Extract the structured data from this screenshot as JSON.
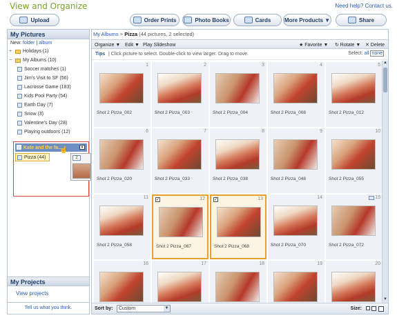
{
  "app": {
    "title": "View and Organize",
    "help_text": "Need help? Contact us."
  },
  "toolbar": {
    "upload": "Upload",
    "order_prints": "Order Prints",
    "photo_books": "Photo Books",
    "cards": "Cards",
    "more_products": "More Products ▼",
    "share": "Share"
  },
  "sidebar": {
    "title": "My Pictures",
    "new_label": "New:",
    "new_folder": "folder",
    "new_sep": "|",
    "new_album": "album",
    "items": [
      {
        "label": "Holidays (1)",
        "kind": "folder",
        "expander": "+"
      },
      {
        "label": "My Albums (10)",
        "kind": "folder",
        "expander": "−"
      },
      {
        "label": "Soccer matches (1)",
        "kind": "album"
      },
      {
        "label": "Jim's Visit to SF (56)",
        "kind": "album"
      },
      {
        "label": "Lacrosse Game (183)",
        "kind": "album"
      },
      {
        "label": "Kids Pool Party (54)",
        "kind": "album"
      },
      {
        "label": "Earth Day (7)",
        "kind": "album"
      },
      {
        "label": "Snow (3)",
        "kind": "album"
      },
      {
        "label": "Valentine's Day (28)",
        "kind": "album"
      },
      {
        "label": "Playing outdoors (12)",
        "kind": "album"
      }
    ],
    "selected_album": "Kate and the fa...",
    "pizza_album": "Pizza (44)",
    "drag_count": "2",
    "projects_title": "My Projects",
    "view_projects": "View projects",
    "tell_us": "Tell us what you think."
  },
  "main": {
    "breadcrumb_root": "My Albums",
    "breadcrumb_sep": ">",
    "breadcrumb_current": "Pizza",
    "breadcrumb_info": "(44 pictures, 2 selected)",
    "organize": "Organize ▼",
    "edit": "Edit ▼",
    "play_slideshow": "Play Slideshow",
    "favorite": "★ Favorite ▼",
    "rotate": "↻ Rotate ▼",
    "delete": "✕ Delete",
    "tips_label": "Tips",
    "tips_text": "|  Click picture to select. Double-click to view larger. Drag to move.",
    "select_label": "Select:",
    "select_all": "all",
    "select_none": "none",
    "sort_label": "Sort by:",
    "sort_value": "Custom",
    "size_label": "Size:"
  },
  "photos": [
    {
      "n": "1",
      "caption": "Shot 2 Pizza_002",
      "selected": false
    },
    {
      "n": "2",
      "caption": "Shot 2 Pizza_003",
      "selected": false
    },
    {
      "n": "3",
      "caption": "Shot 2 Pizza_004",
      "selected": false
    },
    {
      "n": "4",
      "caption": "Shot 2 Pizza_008",
      "selected": false
    },
    {
      "n": "5",
      "caption": "Shot 2 Pizza_012",
      "selected": false
    },
    {
      "n": "6",
      "caption": "Shot 2 Pizza_020",
      "selected": false
    },
    {
      "n": "7",
      "caption": "Shot 2 Pizza_033",
      "selected": false
    },
    {
      "n": "8",
      "caption": "Shot 2 Pizza_038",
      "selected": false
    },
    {
      "n": "9",
      "caption": "Shot 2 Pizza_048",
      "selected": false
    },
    {
      "n": "10",
      "caption": "Shot 2 Pizza_055",
      "selected": false
    },
    {
      "n": "11",
      "caption": "Shot 2 Pizza_058",
      "selected": false
    },
    {
      "n": "12",
      "caption": "Shot 2 Pizza_067",
      "selected": true
    },
    {
      "n": "13",
      "caption": "Shot 2 Pizza_068",
      "selected": true
    },
    {
      "n": "14",
      "caption": "Shot 2 Pizza_070",
      "selected": false
    },
    {
      "n": "15",
      "caption": "Shot 2 Pizza_072",
      "selected": false
    },
    {
      "n": "16",
      "caption": "",
      "selected": false
    },
    {
      "n": "17",
      "caption": "",
      "selected": false
    },
    {
      "n": "18",
      "caption": "",
      "selected": false
    },
    {
      "n": "19",
      "caption": "",
      "selected": false
    },
    {
      "n": "20",
      "caption": "",
      "selected": false
    }
  ]
}
